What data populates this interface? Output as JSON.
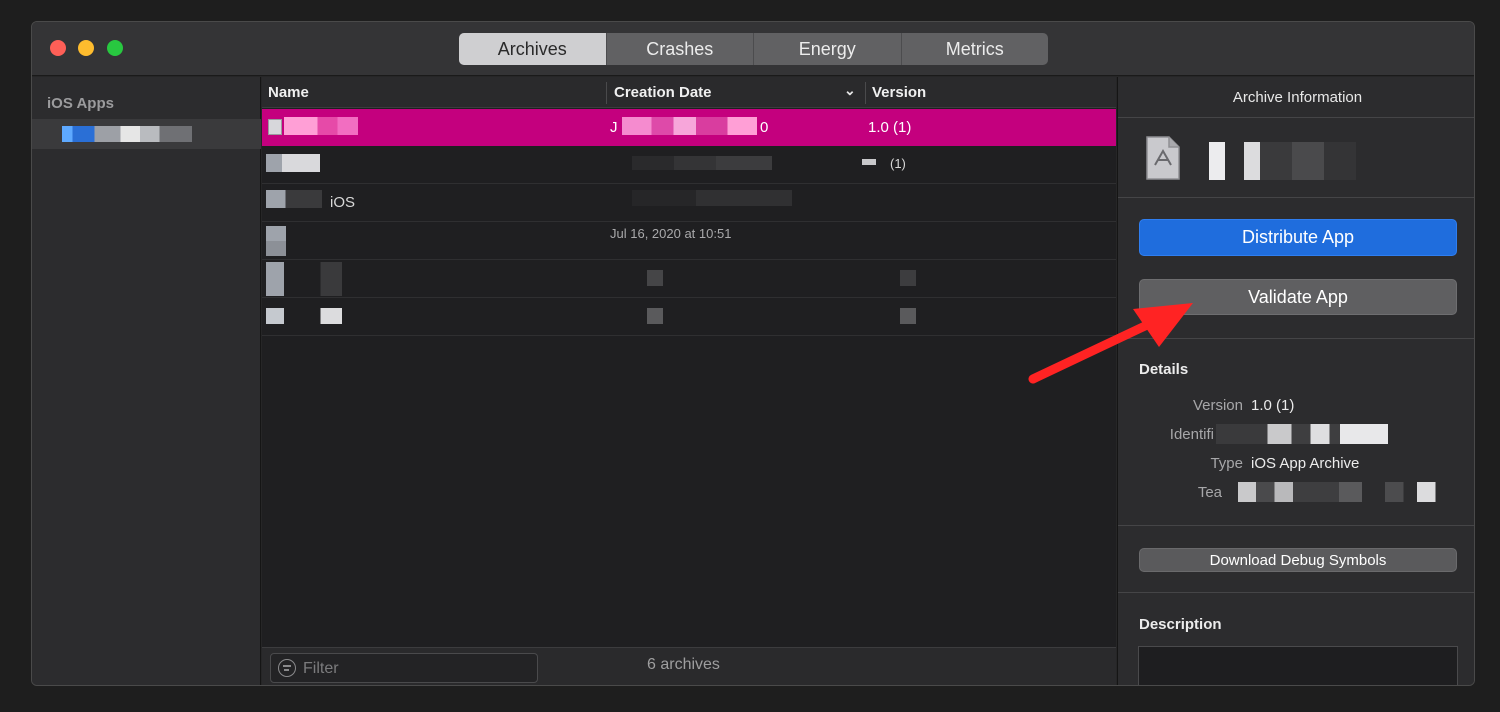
{
  "tabs": [
    {
      "label": "Archives",
      "active": true
    },
    {
      "label": "Crashes",
      "active": false
    },
    {
      "label": "Energy",
      "active": false
    },
    {
      "label": "Metrics",
      "active": false
    }
  ],
  "sidebar": {
    "heading": "iOS Apps"
  },
  "table": {
    "columns": {
      "name": "Name",
      "date": "Creation Date",
      "version": "Version"
    },
    "rows": [
      {
        "name": "",
        "date": "J",
        "date_tail": "0",
        "version": "1.0 (1)",
        "selected": true
      },
      {
        "name": "",
        "date": "",
        "version": "(1)",
        "selected": false
      },
      {
        "name": "iOS",
        "date": "",
        "version": "",
        "selected": false
      },
      {
        "name": "",
        "date": "Jul 16, 2020 at 10:51",
        "version": "",
        "selected": false
      },
      {
        "name": "",
        "date": "",
        "version": "",
        "selected": false
      },
      {
        "name": "",
        "date": "",
        "version": "",
        "selected": false
      }
    ]
  },
  "footer": {
    "filter_placeholder": "Filter",
    "count": "6 archives"
  },
  "inspector": {
    "title": "Archive Information",
    "distribute_label": "Distribute App",
    "validate_label": "Validate App",
    "details_heading": "Details",
    "version_label": "Version",
    "version_value": "1.0 (1)",
    "identifier_label": "Identifi",
    "type_label": "Type",
    "type_value": "iOS App Archive",
    "team_label": "Tea",
    "debug_symbols_label": "Download Debug Symbols",
    "description_heading": "Description"
  },
  "colors": {
    "selection": "#c4007e",
    "primary_button": "#1f6ddd",
    "annotation_arrow": "#ff2323"
  }
}
